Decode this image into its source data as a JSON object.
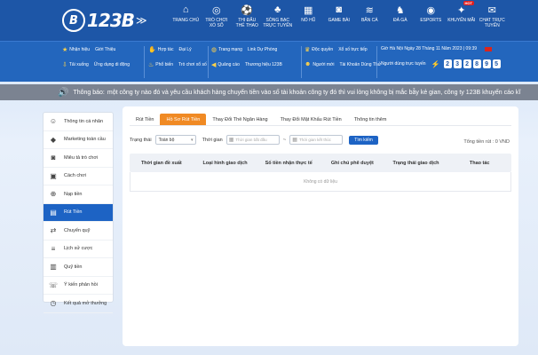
{
  "header": {
    "logo": {
      "mark": "B",
      "text": "123B"
    },
    "nav": [
      {
        "icon": "home-icon",
        "glyph": "⌂",
        "label": "TRANG CHỦ"
      },
      {
        "icon": "lottery-icon",
        "glyph": "◎",
        "label": "TRÒ CHƠI\nXỔ SỐ"
      },
      {
        "icon": "sports-icon",
        "glyph": "⚽",
        "label": "THI ĐẤU\nTHỂ THAO"
      },
      {
        "icon": "casino-icon",
        "glyph": "♣",
        "label": "SÒNG BẠC\nTRỰC TUYẾN"
      },
      {
        "icon": "slots-icon",
        "glyph": "▦",
        "label": "NỔ HŨ"
      },
      {
        "icon": "gamepad-icon",
        "glyph": "◙",
        "label": "GAME BÀI"
      },
      {
        "icon": "fish-icon",
        "glyph": "≋",
        "label": "BẮN CÁ"
      },
      {
        "icon": "rooster-icon",
        "glyph": "♞",
        "label": "ĐÁ GÀ"
      },
      {
        "icon": "esports-icon",
        "glyph": "◉",
        "label": "ESPORTS"
      },
      {
        "icon": "gift-icon",
        "glyph": "✦",
        "label": "KHUYẾN MÃI",
        "badge": "HOT"
      },
      {
        "icon": "chat-icon",
        "glyph": "✉",
        "label": "CHAT TRỰC\nTUYẾN"
      }
    ]
  },
  "info": {
    "group1_row1": [
      "Nhận hiệu",
      "Giới Thiệu"
    ],
    "group1_row2": [
      "Tải xuống",
      "Ứng dụng di động"
    ],
    "group2_row1": [
      "Hợp tác",
      "Đại Lý"
    ],
    "group2_row2": [
      "Phổ biến",
      "Trò chơi xổ số"
    ],
    "group3_row1": [
      "Trang mạng",
      "Link Dự Phòng"
    ],
    "group3_row2": [
      "Quảng cáo",
      "Thương hiệu 123B"
    ],
    "group4_row1": [
      "Độc quyền",
      "Xổ số trực tiếp"
    ],
    "group4_row2": [
      "Người mới",
      "Tài Khoản Dùng Thử"
    ],
    "clock": "Giờ Hà Nội   Ngày 28 Tháng 11 Năm 2023 | 09:39",
    "online_label": "Người dùng trực tuyến",
    "jackpot_digits": [
      "2",
      "3",
      "2",
      "8",
      "9",
      "5"
    ]
  },
  "announcement": {
    "label": "Thông báo:",
    "text": "một công ty nào đó và yêu cầu khách hàng chuyển tiền vào số tài khoản công ty đó thì vui lòng không bị mắc bẫy kẻ gian, công ty 123B khuyến cáo kĩ"
  },
  "sidebar": [
    {
      "icon": "user-icon",
      "glyph": "☺",
      "label": "Thông tin cá nhân"
    },
    {
      "icon": "diamond-icon",
      "glyph": "◆",
      "label": "Marketing toàn cầu"
    },
    {
      "icon": "gamepad-icon",
      "glyph": "◙",
      "label": "Miêu tả trò chơi"
    },
    {
      "icon": "wallet-icon",
      "glyph": "▣",
      "label": "Cách chơi"
    },
    {
      "icon": "deposit-icon",
      "glyph": "⊕",
      "label": "Nạp tiền"
    },
    {
      "icon": "withdraw-icon",
      "glyph": "▤",
      "label": "Rút Tiền",
      "active": true
    },
    {
      "icon": "transfer-icon",
      "glyph": "⇄",
      "label": "Chuyển quỹ"
    },
    {
      "icon": "history-icon",
      "glyph": "≡",
      "label": "Lịch sử cược"
    },
    {
      "icon": "fund-icon",
      "glyph": "▥",
      "label": "Quỹ tiền"
    },
    {
      "icon": "feedback-icon",
      "glyph": "☏",
      "label": "Ý kiến phản hồi"
    },
    {
      "icon": "clock-icon",
      "glyph": "◷",
      "label": "Kết quả mở thưởng"
    }
  ],
  "main": {
    "tabs": [
      "Rút Tiền",
      "Hồ Sơ Rút Tiền",
      "Thay Đổi Thẻ Ngân Hàng",
      "Thay Đổi Mật Khẩu Rút Tiền",
      "Thông tin thêm"
    ],
    "active_tab": 1,
    "filters": {
      "status_label": "Trạng thái",
      "status_value": "Toàn bộ",
      "time_label": "Thời gian",
      "start_placeholder": "Thời gian bắt đầu",
      "end_placeholder": "Thời gian kết thúc",
      "search_label": "Tìm kiếm"
    },
    "total": "Tổng tiền rút : 0 VND",
    "columns": [
      "Thời gian đề xuất",
      "Loại hình giao dịch",
      "Số tiền nhận thực tế",
      "Ghi chú phê duyệt",
      "Trạng thái giao dịch",
      "Thao tác"
    ],
    "empty_text": "Không có dữ liệu"
  },
  "colors": {
    "header_bg": "#1d56a7",
    "accent_orange": "#f08a24",
    "active_blue": "#1d63c4"
  }
}
